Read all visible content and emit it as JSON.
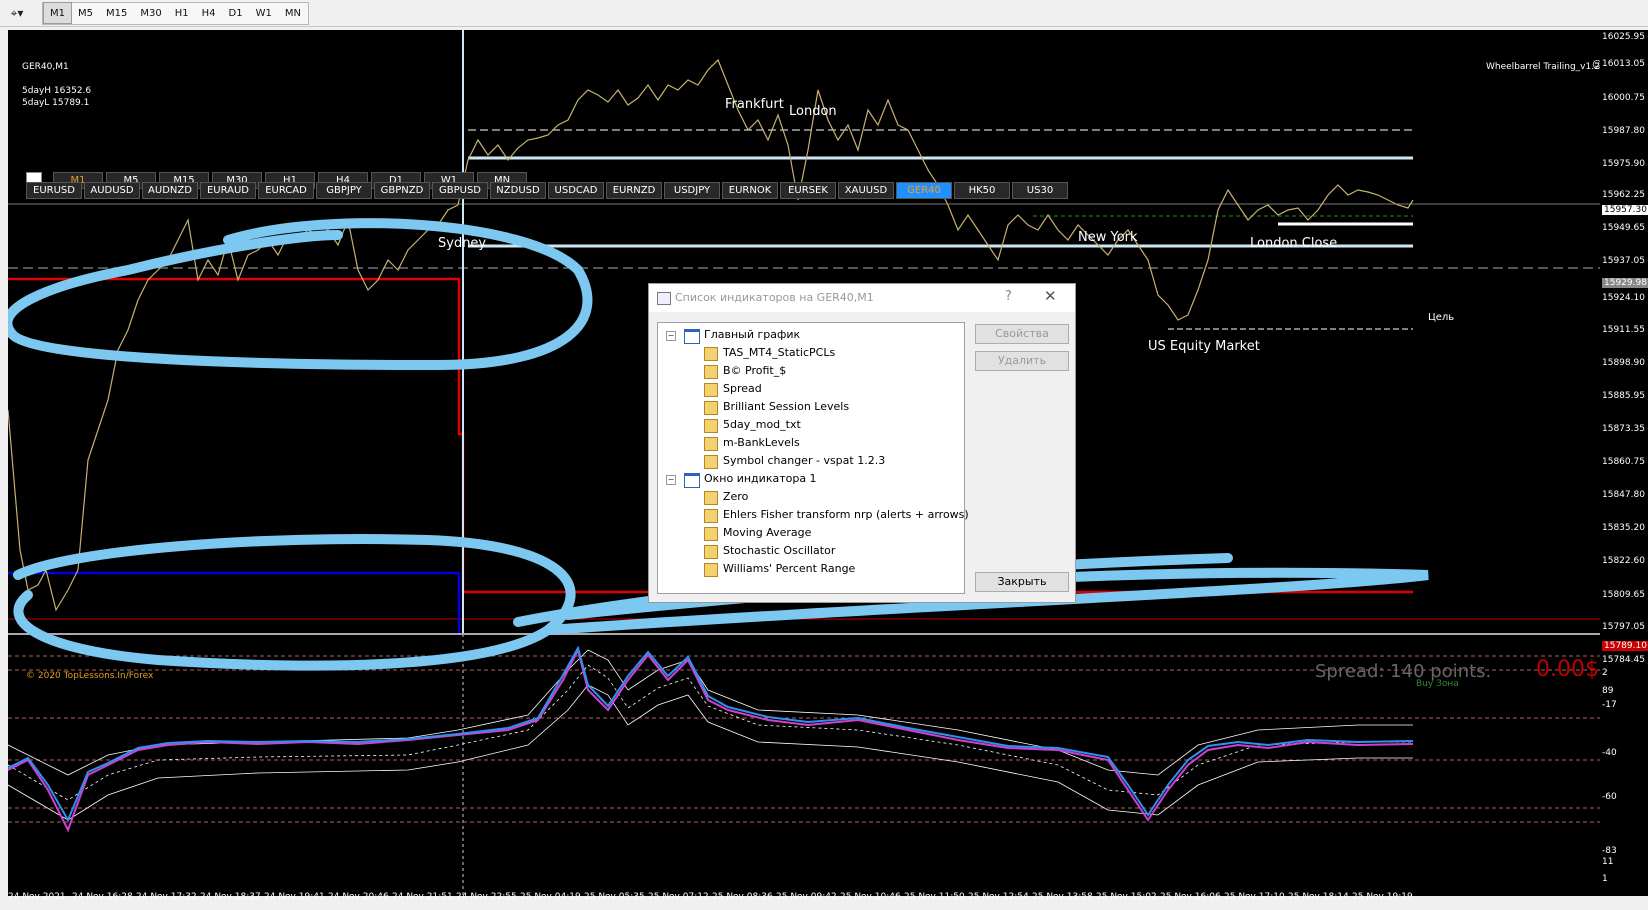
{
  "toolbar": {
    "tool_icon": "cursor-dropdown-icon",
    "timeframes": [
      "M1",
      "M5",
      "M15",
      "M30",
      "H1",
      "H4",
      "D1",
      "W1",
      "MN"
    ],
    "active_timeframe": "M1"
  },
  "chart": {
    "symbol_title": "GER40,M1",
    "info_lines": [
      "5dayH 16352.6",
      "5dayL 15789.1"
    ],
    "ea_label": "Wheelbarrel Trailing_v1.2",
    "price_labels": [
      "16025.95",
      "16013.05",
      "16000.75",
      "15987.80",
      "15975.90",
      "15962.25",
      "15957.30",
      "15949.65",
      "15937.05",
      "15929.98",
      "15924.10",
      "15911.55",
      "15898.90",
      "15885.95",
      "15873.35",
      "15860.75",
      "15847.80",
      "15835.20",
      "15822.60",
      "15809.65",
      "15797.05",
      "15789.10",
      "15784.45"
    ],
    "indicator_labels": [
      "2",
      "89",
      "-17",
      "-40",
      "-60",
      "-83",
      "11",
      "1"
    ],
    "time_labels": [
      "24 Nov 2021",
      "24 Nov 16:28",
      "24 Nov 17:32",
      "24 Nov 18:37",
      "24 Nov 19:41",
      "24 Nov 20:46",
      "24 Nov 21:51",
      "24 Nov 22:55",
      "25 Nov 04:19",
      "25 Nov 05:35",
      "25 Nov 07:12",
      "25 Nov 08:36",
      "25 Nov 09:42",
      "25 Nov 10:46",
      "25 Nov 11:50",
      "25 Nov 12:54",
      "25 Nov 13:58",
      "25 Nov 15:02",
      "25 Nov 16:06",
      "25 Nov 17:10",
      "25 Nov 18:14",
      "25 Nov 19:19"
    ],
    "sessions": [
      "Frankfurt",
      "London",
      "Sydney",
      "New York",
      "London Close",
      "US Equity Market"
    ],
    "target_label": "Цель",
    "tf_buttons": [
      "M1",
      "M5",
      "M15",
      "M30",
      "H1",
      "H4",
      "D1",
      "W1",
      "MN"
    ],
    "symbol_buttons": [
      "EURUSD",
      "AUDUSD",
      "AUDNZD",
      "EURAUD",
      "EURCAD",
      "GBPJPY",
      "GBPNZD",
      "GBPUSD",
      "NZDUSD",
      "USDCAD",
      "EURNZD",
      "USDJPY",
      "EURNOK",
      "EURSEK",
      "XAUUSD",
      "GER40",
      "HK50",
      "US30"
    ],
    "selected_symbol": "GER40",
    "spread_text": "Spread: 140 points.",
    "profit_text": "0.00$",
    "buy_zone": "Buy Зона",
    "copyright": "© 2020 TopLessons.In/Forex"
  },
  "dialog": {
    "title": "Список индикаторов на GER40,M1",
    "help": "?",
    "close": "✕",
    "tree": [
      {
        "level": 0,
        "label": "Главный график",
        "type": "window"
      },
      {
        "level": 1,
        "label": "TAS_MT4_StaticPCLs",
        "type": "indicator"
      },
      {
        "level": 1,
        "label": "B© Profit_$",
        "type": "indicator"
      },
      {
        "level": 1,
        "label": "Spread",
        "type": "indicator"
      },
      {
        "level": 1,
        "label": "Brilliant Session Levels",
        "type": "indicator"
      },
      {
        "level": 1,
        "label": "5day_mod_txt",
        "type": "indicator"
      },
      {
        "level": 1,
        "label": "m-BankLevels",
        "type": "indicator"
      },
      {
        "level": 1,
        "label": "Symbol changer - vspat 1.2.3",
        "type": "indicator"
      },
      {
        "level": 0,
        "label": "Окно индикатора 1",
        "type": "window"
      },
      {
        "level": 1,
        "label": "Zero",
        "type": "indicator"
      },
      {
        "level": 1,
        "label": "Ehlers Fisher transform nrp (alerts + arrows)",
        "type": "indicator"
      },
      {
        "level": 1,
        "label": "Moving Average",
        "type": "indicator"
      },
      {
        "level": 1,
        "label": "Stochastic Oscillator",
        "type": "indicator"
      },
      {
        "level": 1,
        "label": "Williams' Percent Range",
        "type": "indicator"
      }
    ],
    "buttons": {
      "properties": "Свойства",
      "delete": "Удалить",
      "close": "Закрыть"
    }
  },
  "colors": {
    "highlight": "#7cc8f0",
    "red_line": "#e00000",
    "blue_line": "#0000e0",
    "indicator_magenta": "#d040d0",
    "indicator_blue": "#3090f0"
  }
}
